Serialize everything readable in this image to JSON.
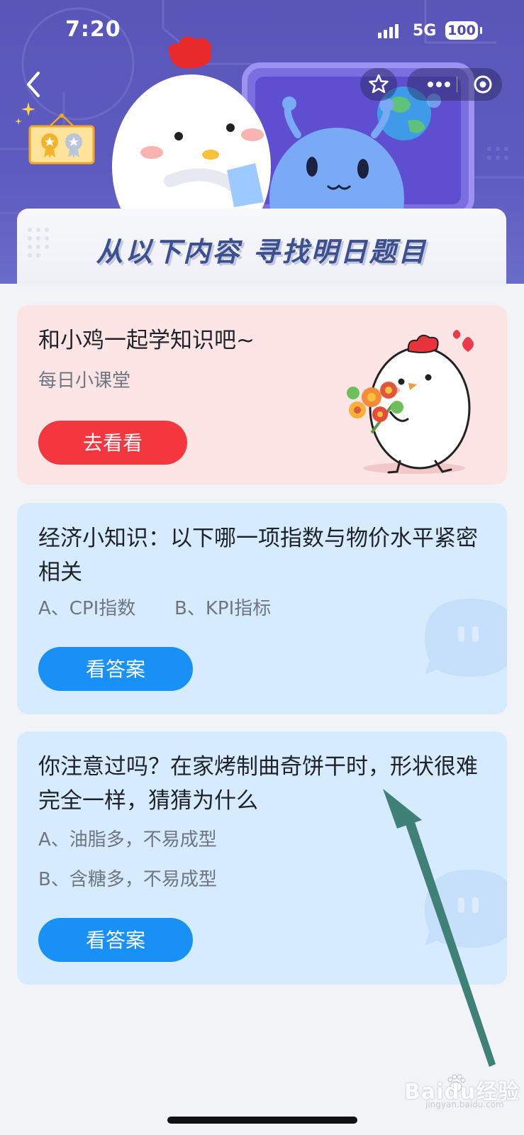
{
  "status_bar": {
    "time": "7:20",
    "network": "5G",
    "battery": "100"
  },
  "header": {
    "banner_title": "从以下内容  寻找明日题目"
  },
  "cards": [
    {
      "title": "和小鸡一起学知识吧~",
      "subtitle": "每日小课堂",
      "button_label": "去看看"
    },
    {
      "title": "经济小知识：以下哪一项指数与物价水平紧密相关",
      "options": [
        "A、CPI指数",
        "B、KPI指标"
      ],
      "button_label": "看答案"
    },
    {
      "title": "你注意过吗？在家烤制曲奇饼干时，形状很难完全一样，猜猜为什么",
      "options": [
        "A、油脂多，不易成型",
        "B、含糖多，不易成型"
      ],
      "button_label": "看答案"
    }
  ],
  "watermark": {
    "text": "Baidu经验",
    "sub": "jingyan.baidu.com"
  },
  "colors": {
    "header": "#5a56b8",
    "accent_blue": "#1990f5",
    "accent_red": "#f4373f",
    "arrow": "#3f8077"
  }
}
